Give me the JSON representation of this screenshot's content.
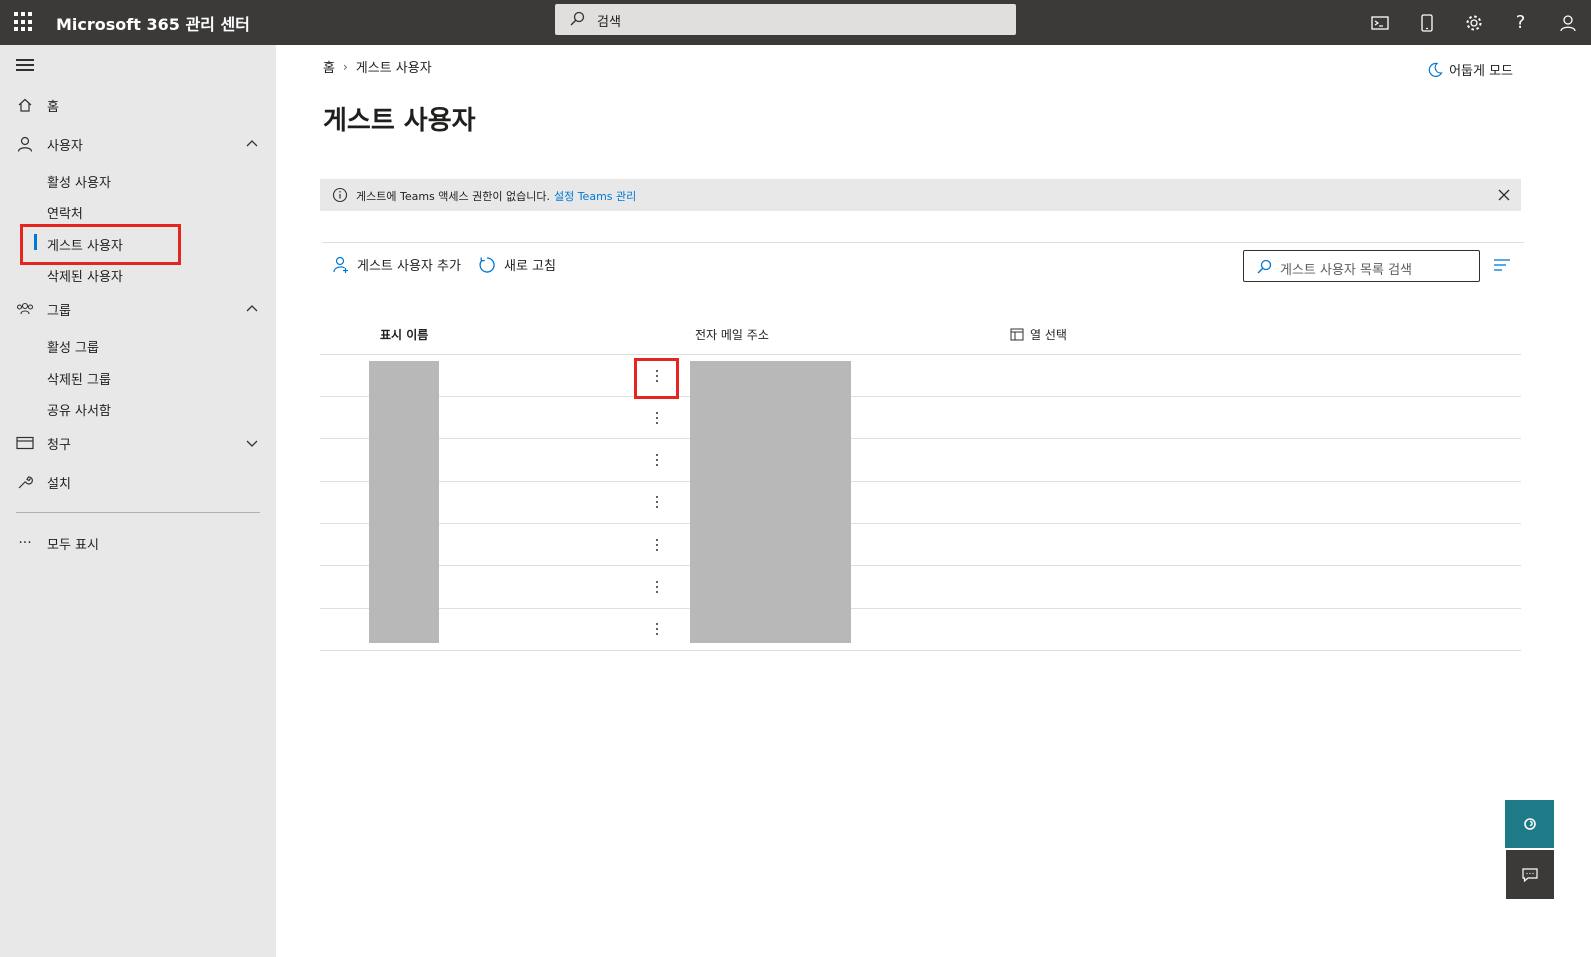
{
  "topbar": {
    "app_title": "Microsoft 365 관리 센터",
    "search_placeholder": "검색",
    "icons": [
      "waffle-icon",
      "terminal-icon",
      "mobile-icon",
      "gear-icon",
      "help-icon",
      "user-icon"
    ]
  },
  "sidebar": {
    "home": "홈",
    "users": "사용자",
    "users_sub": [
      "활성 사용자",
      "연락처",
      "게스트 사용자",
      "삭제된 사용자"
    ],
    "groups": "그룹",
    "groups_sub": [
      "활성 그룹",
      "삭제된 그룹",
      "공유 사서함"
    ],
    "billing": "청구",
    "setup": "설치",
    "show_all": "모두 표시"
  },
  "breadcrumb": {
    "home": "홈",
    "current": "게스트 사용자"
  },
  "dark_mode_label": "어둡게 모드",
  "page_title": "게스트 사용자",
  "banner": {
    "text": "게스트에 Teams 액세스 권한이 없습니다.",
    "link": "설정 Teams 관리"
  },
  "toolbar": {
    "add_guest": "게스트 사용자 추가",
    "refresh": "새로 고침",
    "search_placeholder": "게스트 사용자 목록 검색"
  },
  "table": {
    "columns": {
      "display_name": "표시 이름",
      "email": "전자 메일 주소",
      "choose_columns": "열 선택"
    },
    "row_count": 7
  },
  "colors": {
    "accent": "#0078d4",
    "topbar": "#3b3a39",
    "sidebar": "#e8e8e8",
    "highlight": "#e5261f",
    "help": "#1f7a87"
  }
}
